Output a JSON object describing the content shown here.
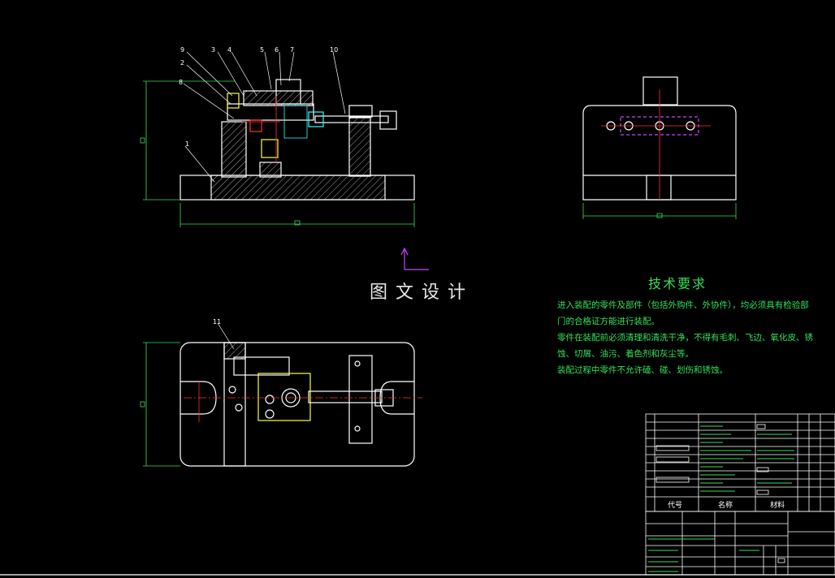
{
  "watermark": "图文设计",
  "tech_requirements": {
    "title": "技术要求",
    "lines": [
      "进入装配的零件及部件（包括外购件、外协件），均必须具有检验部",
      "门的合格证方能进行装配。",
      "零件在装配前必须清理和清洗干净，不得有毛刺、飞边、氧化皮、锈",
      "蚀、切屑、油污、着色剂和灰尘等。",
      "装配过程中零件不允许磕、碰、划伤和锈蚀。"
    ]
  },
  "part_callouts": [
    "9",
    "2",
    "3",
    "4",
    "5",
    "6",
    "7",
    "10",
    "2",
    "8",
    "1",
    "11"
  ],
  "bom_header": {
    "code": "代号",
    "name": "名称",
    "material": "材料"
  },
  "colors": {
    "background": "#000000",
    "outline": "#ffffff",
    "dimension": "#33e05a",
    "centerline": "#ff3030",
    "hidden": "#cc44ff",
    "hatch": "#ffffff",
    "accent_yellow": "#ffff40",
    "accent_cyan": "#30ffff"
  }
}
